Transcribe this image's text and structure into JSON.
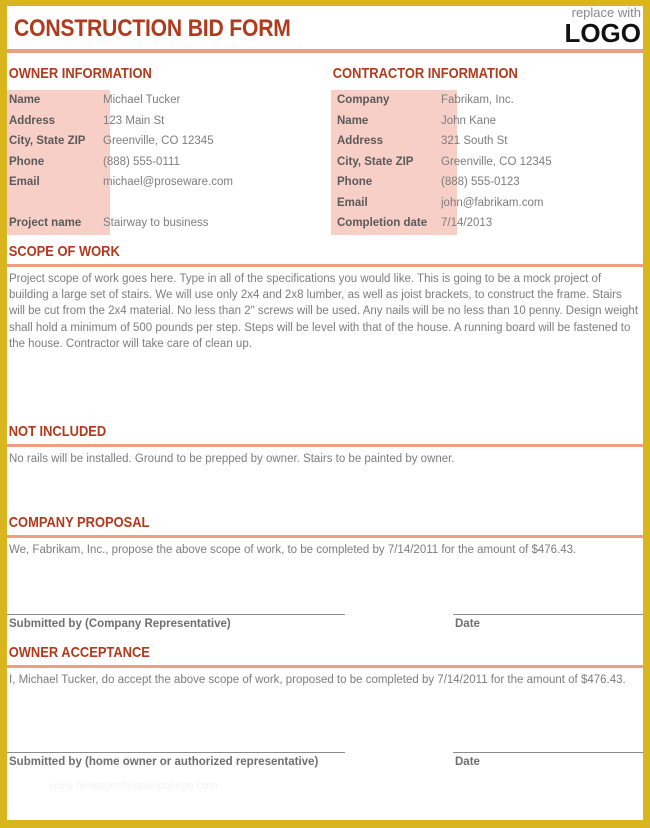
{
  "document": {
    "title": "CONSTRUCTION BID FORM",
    "logo_top": "replace with",
    "logo_main": "LOGO",
    "watermark": "www.heritagechristiancollege.com"
  },
  "colors": {
    "border_gold": "#D9B61E",
    "heading_red": "#B23A1C",
    "rule_salmon": "#EE9E83",
    "label_pink": "#F8CFC6",
    "body_gray": "#7d7d7d"
  },
  "owner_information": {
    "heading": "OWNER INFORMATION",
    "rows": [
      {
        "label": "Name",
        "value": "Michael Tucker"
      },
      {
        "label": "Address",
        "value": "123 Main St"
      },
      {
        "label": "City, State ZIP",
        "value": "Greenville, CO 12345"
      },
      {
        "label": "Phone",
        "value": "(888) 555-0111"
      },
      {
        "label": "Email",
        "value": "michael@proseware.com"
      }
    ],
    "project": {
      "label": "Project name",
      "value": "Stairway to business"
    }
  },
  "contractor_information": {
    "heading": "CONTRACTOR INFORMATION",
    "rows": [
      {
        "label": "Company",
        "value": "Fabrikam, Inc."
      },
      {
        "label": "Name",
        "value": "John Kane"
      },
      {
        "label": "Address",
        "value": "321 South St"
      },
      {
        "label": "City, State ZIP",
        "value": "Greenville, CO 12345"
      },
      {
        "label": "Phone",
        "value": "(888) 555-0123"
      },
      {
        "label": "Email",
        "value": "john@fabrikam.com"
      },
      {
        "label": "Completion date",
        "value": "7/14/2013"
      }
    ]
  },
  "scope_of_work": {
    "heading": "SCOPE OF WORK",
    "text": "Project scope of work goes here. Type in all of the specifications you would like. This is going to be a mock project of building a large set of stairs. We will use only 2x4 and 2x8 lumber, as well as joist brackets, to construct the frame. Stairs will be cut from the 2x4 material. No less than 2\" screws will be used.  Any nails will be no less than 10 penny. Design weight shall hold a minimum of 500 pounds per step. Steps will be level with that of the house. A running board will be fastened to the house. Contractor will take care of clean up."
  },
  "not_included": {
    "heading": "NOT INCLUDED",
    "text": "No rails will be installed. Ground to be prepped by owner. Stairs to be painted by owner."
  },
  "company_proposal": {
    "heading": "COMPANY PROPOSAL",
    "text": "We, Fabrikam, Inc., propose the above scope of work, to be completed by 7/14/2011 for the amount of $476.43."
  },
  "company_signature": {
    "name_label": "Submitted by (Company Representative)",
    "date_label": "Date"
  },
  "owner_acceptance": {
    "heading": "OWNER ACCEPTANCE",
    "text": "I, Michael Tucker, do accept the above scope of work, proposed to be completed by 7/14/2011 for the amount of $476.43."
  },
  "owner_signature": {
    "name_label": "Submitted by (home owner or authorized representative)",
    "date_label": "Date"
  }
}
